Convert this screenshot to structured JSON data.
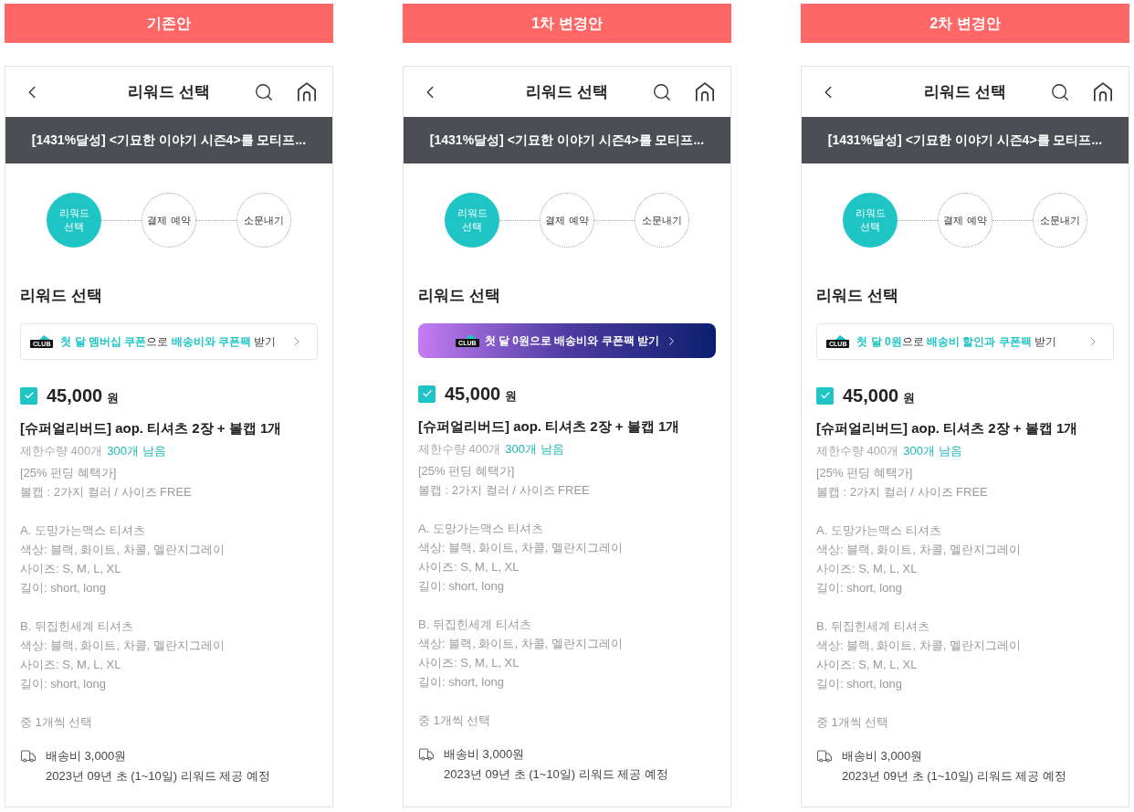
{
  "variants": [
    {
      "label": "기존안",
      "screen": {
        "title": "리워드 선택",
        "notice": "[1431%달성] <기묘한 이야기 시즌4>를 모티프...",
        "steps": [
          {
            "label": "리워드\n선택",
            "selected": true
          },
          {
            "label": "결제 예약",
            "selected": false
          },
          {
            "label": "소문내기",
            "selected": false
          }
        ],
        "section_title": "리워드 선택",
        "coupon": {
          "kind": "outline",
          "badge": "CLUB",
          "text": "**첫 달 멤버십 쿠폰**으로 **배송비와 쿠폰팩** 받기"
        },
        "reward": {
          "checked": true,
          "price": "45,000",
          "currency": "원",
          "name": "[슈퍼얼리버드] aop. 티셔츠 2장 + 볼캡 1개",
          "limit": "제한수량 400개",
          "remaining": "300개 남음",
          "description": [
            [
              "[25% 펀딩 혜택가]",
              "볼캡 : 2가지 컬러 / 사이즈 FREE"
            ],
            [
              "A. 도망가는맥스 티셔츠",
              "색상: 블랙, 화이트, 차콜, 멜란지그레이",
              "사이즈: S, M, L, XL",
              "길이: short, long"
            ],
            [
              "B. 뒤집힌세계 티셔츠",
              "색상: 블랙, 화이트, 차콜, 멜란지그레이",
              "사이즈: S, M, L, XL",
              "길이: short, long"
            ],
            [
              "중 1개씩 선택"
            ]
          ],
          "shipping_fee": "배송비 3,000원",
          "delivery": "2023년 09년 초 (1~10일) 리워드 제공 예정"
        }
      }
    },
    {
      "label": "1차 변경안",
      "screen": {
        "title": "리워드 선택",
        "notice": "[1431%달성] <기묘한 이야기 시즌4>를 모티프...",
        "steps": [
          {
            "label": "리워드\n선택",
            "selected": true
          },
          {
            "label": "결제 예약",
            "selected": false
          },
          {
            "label": "소문내기",
            "selected": false
          }
        ],
        "section_title": "리워드 선택",
        "coupon": {
          "kind": "gradient",
          "badge": "CLUB",
          "text": "첫 달 0원으로 배송비와 쿠폰팩 받기"
        },
        "reward": {
          "checked": true,
          "price": "45,000",
          "currency": "원",
          "name": "[슈퍼얼리버드] aop. 티셔츠 2장 + 볼캡 1개",
          "limit": "제한수량 400개",
          "remaining": "300개 남음",
          "description": [
            [
              "[25% 펀딩 혜택가]",
              "볼캡 : 2가지 컬러 / 사이즈 FREE"
            ],
            [
              "A. 도망가는맥스 티셔츠",
              "색상: 블랙, 화이트, 차콜, 멜란지그레이",
              "사이즈: S, M, L, XL",
              "길이: short, long"
            ],
            [
              "B. 뒤집힌세계 티셔츠",
              "색상: 블랙, 화이트, 차콜, 멜란지그레이",
              "사이즈: S, M, L, XL",
              "길이: short, long"
            ],
            [
              "중 1개씩 선택"
            ]
          ],
          "shipping_fee": "배송비 3,000원",
          "delivery": "2023년 09년 초 (1~10일) 리워드 제공 예정"
        }
      }
    },
    {
      "label": "2차 변경안",
      "screen": {
        "title": "리워드 선택",
        "notice": "[1431%달성] <기묘한 이야기 시즌4>를 모티프...",
        "steps": [
          {
            "label": "리워드\n선택",
            "selected": true
          },
          {
            "label": "결제 예약",
            "selected": false
          },
          {
            "label": "소문내기",
            "selected": false
          }
        ],
        "section_title": "리워드 선택",
        "coupon": {
          "kind": "outline",
          "badge": "CLUB",
          "text": "**첫 달 0원**으로 **배송비 할인과 쿠폰팩** 받기"
        },
        "reward": {
          "checked": true,
          "price": "45,000",
          "currency": "원",
          "name": "[슈퍼얼리버드] aop. 티셔츠 2장 + 볼캡 1개",
          "limit": "제한수량 400개",
          "remaining": "300개 남음",
          "description": [
            [
              "[25% 펀딩 혜택가]",
              "볼캡 : 2가지 컬러 / 사이즈 FREE"
            ],
            [
              "A. 도망가는맥스 티셔츠",
              "색상: 블랙, 화이트, 차콜, 멜란지그레이",
              "사이즈: S, M, L, XL",
              "길이: short, long"
            ],
            [
              "B. 뒤집힌세계 티셔츠",
              "색상: 블랙, 화이트, 차콜, 멜란지그레이",
              "사이즈: S, M, L, XL",
              "길이: short, long"
            ],
            [
              "중 1개씩 선택"
            ]
          ],
          "shipping_fee": "배송비 3,000원",
          "delivery": "2023년 09년 초 (1~10일) 리워드 제공 예정"
        }
      }
    }
  ]
}
